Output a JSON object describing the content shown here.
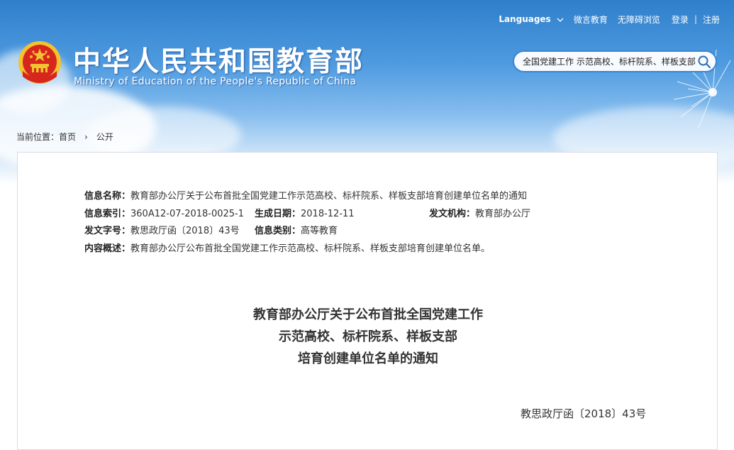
{
  "header": {
    "site_title": "中华人民共和国教育部",
    "site_subtitle": "Ministry of Education of the People's Republic of China",
    "top_links": {
      "languages": "Languages",
      "weiyan": "微言教育",
      "accessible": "无障碍浏览",
      "login": "登录",
      "separator": "|",
      "register": "注册"
    },
    "search_value": "全国党建工作 示范高校、标杆院系、样板支部"
  },
  "breadcrumb": {
    "prefix": "当前位置：",
    "home": "首页",
    "separator": "›",
    "current": "公开"
  },
  "meta": {
    "name_label": "信息名称：",
    "name_value": "教育部办公厅关于公布首批全国党建工作示范高校、标杆院系、样板支部培育创建单位名单的通知",
    "index_label": "信息索引：",
    "index_value": "360A12-07-2018-0025-1",
    "date_label": "生成日期：",
    "date_value": "2018-12-11",
    "org_label": "发文机构：",
    "org_value": "教育部办公厅",
    "docno_label": "发文字号：",
    "docno_value": "教思政厅函〔2018〕43号",
    "category_label": "信息类别：",
    "category_value": "高等教育",
    "summary_label": "内容概述：",
    "summary_value": "教育部办公厅公布首批全国党建工作示范高校、标杆院系、样板支部培育创建单位名单。"
  },
  "document": {
    "title_line1": "教育部办公厅关于公布首批全国党建工作",
    "title_line2": "示范高校、标杆院系、样板支部",
    "title_line3": "培育创建单位名单的通知",
    "doc_number": "教思政厅函〔2018〕43号"
  },
  "colors": {
    "header_blue": "#2f7fcb",
    "search_border": "#3a86d3",
    "emblem_red": "#d7261e",
    "emblem_gold": "#f2c230"
  },
  "icons": {
    "search": "search-icon",
    "chevron": "chevron-down-icon",
    "emblem": "national-emblem-icon"
  }
}
